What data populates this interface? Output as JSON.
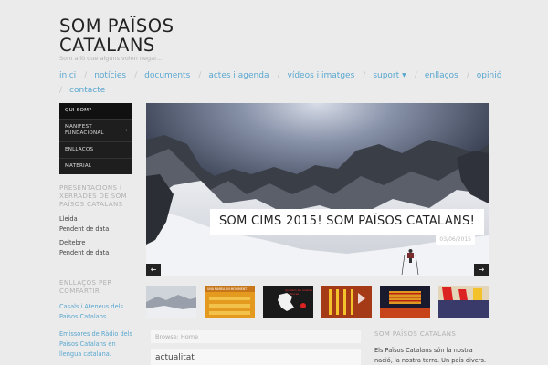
{
  "site": {
    "title_line1": "SOM PAÏSOS",
    "title_line2": "CATALANS",
    "tagline": "Som allò que alguns volen negar..."
  },
  "nav": {
    "items": [
      "inici",
      "notícies",
      "documents",
      "actes i agenda",
      "vídeos i imatges",
      "suport",
      "enllaços",
      "opinió",
      "contacte"
    ],
    "caret": "▼"
  },
  "submenu": {
    "items": [
      {
        "label": "QUI SOM?"
      },
      {
        "label_line1": "MANIFEST",
        "label_line2": "FUNDACIONAL",
        "arrow": "›"
      },
      {
        "label": "ENLLAÇOS"
      },
      {
        "label": "MATERIAL"
      }
    ]
  },
  "sidebar": {
    "events_title": "PRESENTACIONS I XERRADES DE SOM PAÏSOS CATALANS",
    "events": [
      {
        "place": "Lleida",
        "date": "Pendent de data"
      },
      {
        "place": "Deltebre",
        "date": "Pendent de data"
      }
    ],
    "links_title": "ENLLAÇOS PER COMPARTIR",
    "links": [
      "Casals i Ateneus dels Països Catalans.",
      "Emissores de Ràdio dels Països Catalans en llengua catalana."
    ]
  },
  "slider": {
    "caption": "SOM CIMS 2015! SOM PAÏSOS CATALANS!",
    "date": "03/06/2015",
    "prev": "←",
    "next": "→"
  },
  "thumbs": {
    "t2_text_line1": "UNA MAREA EN MOVIMENT",
    "t2_text_line2": "PER LA INDEPENDÈNCIA",
    "t3_text_line1": "Ajuntem les nostres",
    "t3_text_line2": "forces"
  },
  "main": {
    "breadcrumb": "Browse: Home",
    "section_title": "actualitat"
  },
  "right_widget": {
    "title": "SOM PAÏSOS CATALANS",
    "text": "Els Països Catalans són la nostra nació, la nostra terra. Un país divers."
  },
  "colors": {
    "link": "#5aa7cf",
    "background": "#ebebeb",
    "submenu_bg": "#1e1e1e"
  }
}
